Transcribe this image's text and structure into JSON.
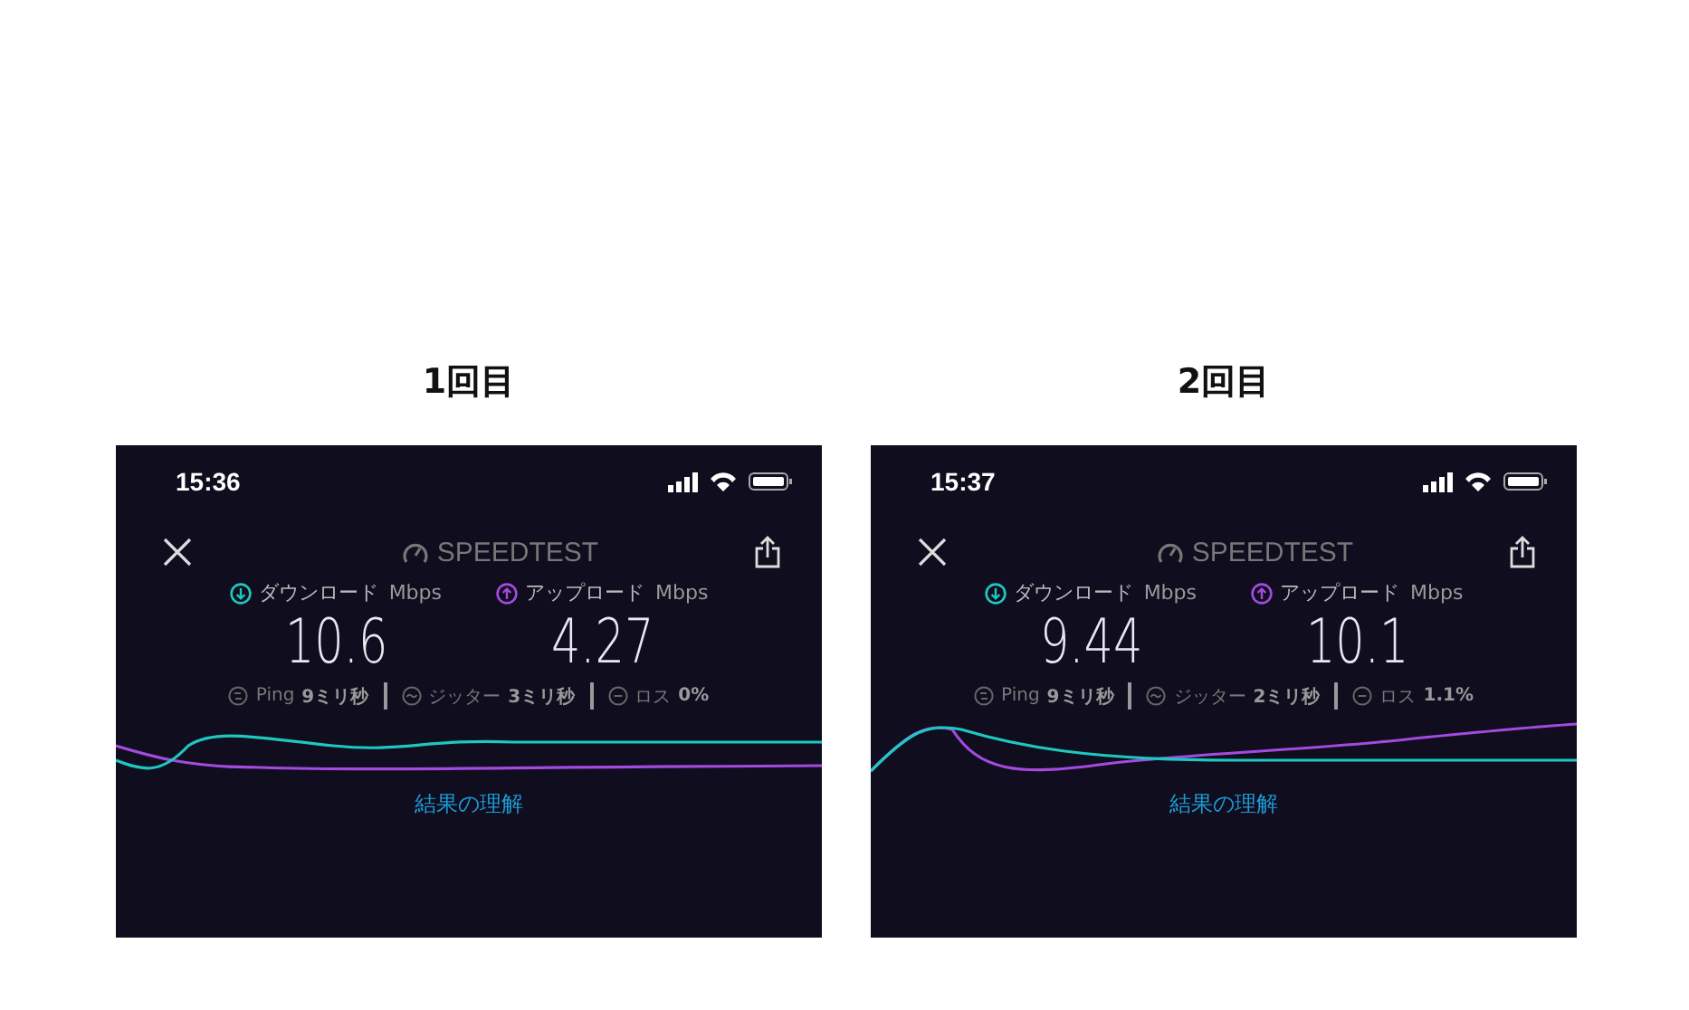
{
  "panels": [
    {
      "heading": "1回目",
      "time": "15:36",
      "logo": "SPEEDTEST",
      "link": "結果の理解",
      "speeds": [
        {
          "kind": "download",
          "label": "ダウンロード",
          "unit": "Mbps",
          "value": "10.6"
        },
        {
          "kind": "upload",
          "label": "アップロード",
          "unit": "Mbps",
          "value": "4.27"
        }
      ],
      "stats": [
        {
          "kind": "ping",
          "label": "Ping",
          "value": "9ミリ秒"
        },
        {
          "kind": "jitter",
          "label": "ジッター",
          "value": "3ミリ秒"
        },
        {
          "kind": "loss",
          "label": "ロス",
          "value": "0%"
        }
      ]
    },
    {
      "heading": "2回目",
      "time": "15:37",
      "logo": "SPEEDTEST",
      "link": "結果の理解",
      "speeds": [
        {
          "kind": "download",
          "label": "ダウンロード",
          "unit": "Mbps",
          "value": "9.44"
        },
        {
          "kind": "upload",
          "label": "アップロード",
          "unit": "Mbps",
          "value": "10.1"
        }
      ],
      "stats": [
        {
          "kind": "ping",
          "label": "Ping",
          "value": "9ミリ秒"
        },
        {
          "kind": "jitter",
          "label": "ジッター",
          "value": "2ミリ秒"
        },
        {
          "kind": "loss",
          "label": "ロス",
          "value": "1.1%"
        }
      ]
    }
  ]
}
